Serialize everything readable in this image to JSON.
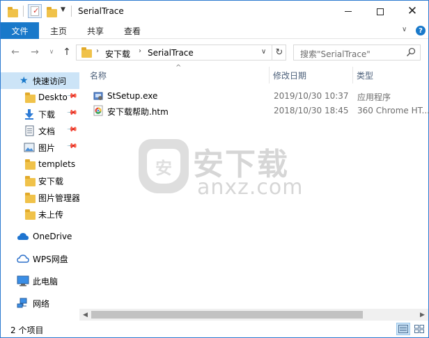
{
  "window": {
    "title": "SerialTrace",
    "controls": {
      "minimize": "minimize",
      "maximize": "maximize",
      "close": "close"
    }
  },
  "ribbon": {
    "tabs": [
      {
        "label": "文件",
        "active": true
      },
      {
        "label": "主页"
      },
      {
        "label": "共享"
      },
      {
        "label": "查看"
      }
    ]
  },
  "address": {
    "crumbs": [
      "安下载",
      "SerialTrace"
    ],
    "search_placeholder": "搜索\"SerialTrace\""
  },
  "nav": {
    "quick_access": {
      "label": "快速访问"
    },
    "items": [
      {
        "label": "Deskto",
        "icon": "folder-icon",
        "pinned": true
      },
      {
        "label": "下载",
        "icon": "download-icon",
        "pinned": true
      },
      {
        "label": "文档",
        "icon": "document-icon",
        "pinned": true
      },
      {
        "label": "图片",
        "icon": "picture-icon",
        "pinned": true
      },
      {
        "label": "templets",
        "icon": "folder-icon",
        "pinned": false
      },
      {
        "label": "安下载",
        "icon": "folder-icon",
        "pinned": false
      },
      {
        "label": "图片管理器",
        "icon": "folder-icon",
        "pinned": false
      },
      {
        "label": "未上传",
        "icon": "folder-icon",
        "pinned": false
      }
    ],
    "locations": [
      {
        "label": "OneDrive",
        "icon": "cloud-icon"
      },
      {
        "label": "WPS网盘",
        "icon": "wps-cloud-icon"
      },
      {
        "label": "此电脑",
        "icon": "computer-icon"
      },
      {
        "label": "网络",
        "icon": "network-icon"
      }
    ]
  },
  "columns": {
    "name": "名称",
    "date": "修改日期",
    "type": "类型"
  },
  "files": [
    {
      "name": "StSetup.exe",
      "date": "2019/10/30 10:37",
      "type": "应用程序",
      "icon": "installer-icon"
    },
    {
      "name": "安下载帮助.htm",
      "date": "2018/10/30 18:45",
      "type": "360 Chrome HT...",
      "icon": "html-icon"
    }
  ],
  "watermark": {
    "shield_char": "安",
    "big_text": "安下载",
    "small_text": "anxz.com"
  },
  "status": {
    "item_count": "2 个项目"
  },
  "colors": {
    "accent": "#1979ca",
    "selected": "#cce4f7",
    "folder": "#f0c24a"
  }
}
